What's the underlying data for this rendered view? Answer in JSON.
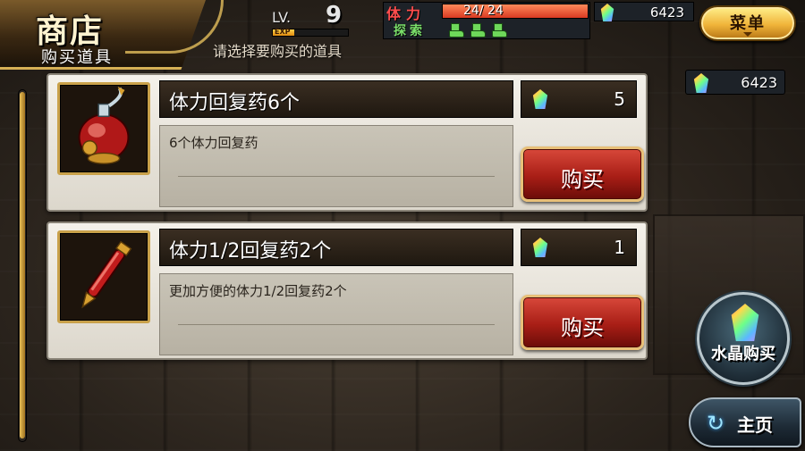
{
  "header": {
    "title": "商店",
    "subtitle": "购买道具",
    "hint": "请选择要购买的道具"
  },
  "player": {
    "level_label": "LV.",
    "level": "9",
    "exp_label": "EXP",
    "exp_progress": 0.28,
    "stamina_label": "体力",
    "stamina_value": "24/ 24",
    "stamina_progress": 1.0,
    "explore_label": "探索",
    "explore_boots": 3,
    "crystals": "6423"
  },
  "menu": {
    "label": "菜单",
    "icon": "chevron-down-icon"
  },
  "crystal_balance": "6423",
  "items": [
    {
      "name": "体力回复药6个",
      "price": "5",
      "description": "6个体力回复药",
      "buy_label": "购买",
      "icon": "red-potion-flask-icon"
    },
    {
      "name": "体力1/2回复药2个",
      "price": "1",
      "description": "更加方便的体力1/2回复药2个",
      "buy_label": "购买",
      "icon": "red-potion-vial-icon"
    }
  ],
  "crystal_buy": {
    "label": "水晶购买",
    "icon": "rainbow-crystal-icon"
  },
  "home": {
    "label": "主页",
    "icon": "return-arrow-icon"
  },
  "colors": {
    "accent_gold": "#d7b055",
    "buy_red": "#a81e16",
    "stamina_red": "#ff4d4d",
    "explore_green": "#6ed85a"
  }
}
